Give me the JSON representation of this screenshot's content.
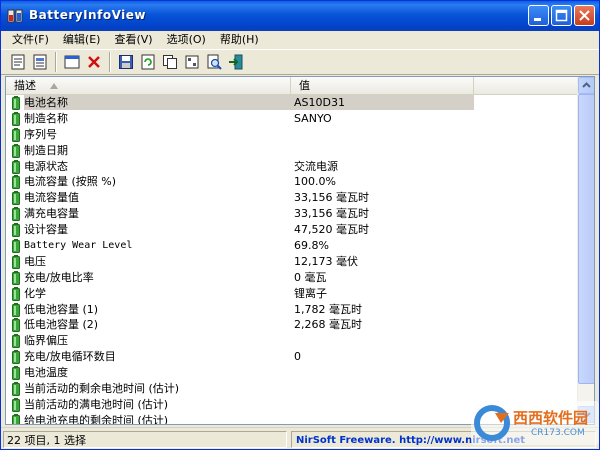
{
  "window": {
    "title": "BatteryInfoView"
  },
  "menu": [
    {
      "label": "文件(F)"
    },
    {
      "label": "编辑(E)"
    },
    {
      "label": "查看(V)"
    },
    {
      "label": "选项(O)"
    },
    {
      "label": "帮助(H)"
    }
  ],
  "toolbar": {
    "icons": [
      "properties-icon",
      "html-report-icon",
      "select-all-icon",
      "delete-icon",
      "save-icon",
      "refresh-icon",
      "copy-icon",
      "options-icon",
      "find-icon",
      "exit-icon"
    ]
  },
  "list": {
    "columns": [
      "描述",
      "值"
    ],
    "rows": [
      {
        "desc": "电池名称",
        "value": "AS10D31",
        "selected": true
      },
      {
        "desc": "制造名称",
        "value": "SANYO"
      },
      {
        "desc": "序列号",
        "value": ""
      },
      {
        "desc": "制造日期",
        "value": ""
      },
      {
        "desc": "电源状态",
        "value": "交流电源"
      },
      {
        "desc": "电流容量 (按照 %)",
        "value": "100.0%"
      },
      {
        "desc": "电流容量值",
        "value": "33,156 毫瓦时"
      },
      {
        "desc": "满充电容量",
        "value": "33,156 毫瓦时"
      },
      {
        "desc": "设计容量",
        "value": "47,520 毫瓦时"
      },
      {
        "desc": "Battery Wear Level",
        "value": "69.8%",
        "mono": true
      },
      {
        "desc": "电压",
        "value": "12,173 毫伏"
      },
      {
        "desc": "充电/放电比率",
        "value": "0 毫瓦"
      },
      {
        "desc": "化学",
        "value": "锂离子"
      },
      {
        "desc": "低电池容量 (1)",
        "value": "1,782 毫瓦时"
      },
      {
        "desc": "低电池容量 (2)",
        "value": "2,268 毫瓦时"
      },
      {
        "desc": "临界偏压",
        "value": ""
      },
      {
        "desc": "充电/放电循环数目",
        "value": "0"
      },
      {
        "desc": "电池温度",
        "value": ""
      },
      {
        "desc": "当前活动的剩余电池时间 (估计)",
        "value": ""
      },
      {
        "desc": "当前活动的满电池时间 (估计)",
        "value": ""
      },
      {
        "desc": "给电池充电的剩余时间 (估计)",
        "value": ""
      }
    ]
  },
  "status": {
    "left": "22 项目, 1 选择",
    "right": "NirSoft Freeware.  http://www.nirsoft.net"
  },
  "watermark": {
    "brand": "西西软件园",
    "url": "CR173.COM"
  },
  "colors": {
    "titlebar": "#0a5fe6",
    "row_icon": "#3aa63a",
    "selection": "#d4d0c8",
    "link": "#0033cc"
  }
}
